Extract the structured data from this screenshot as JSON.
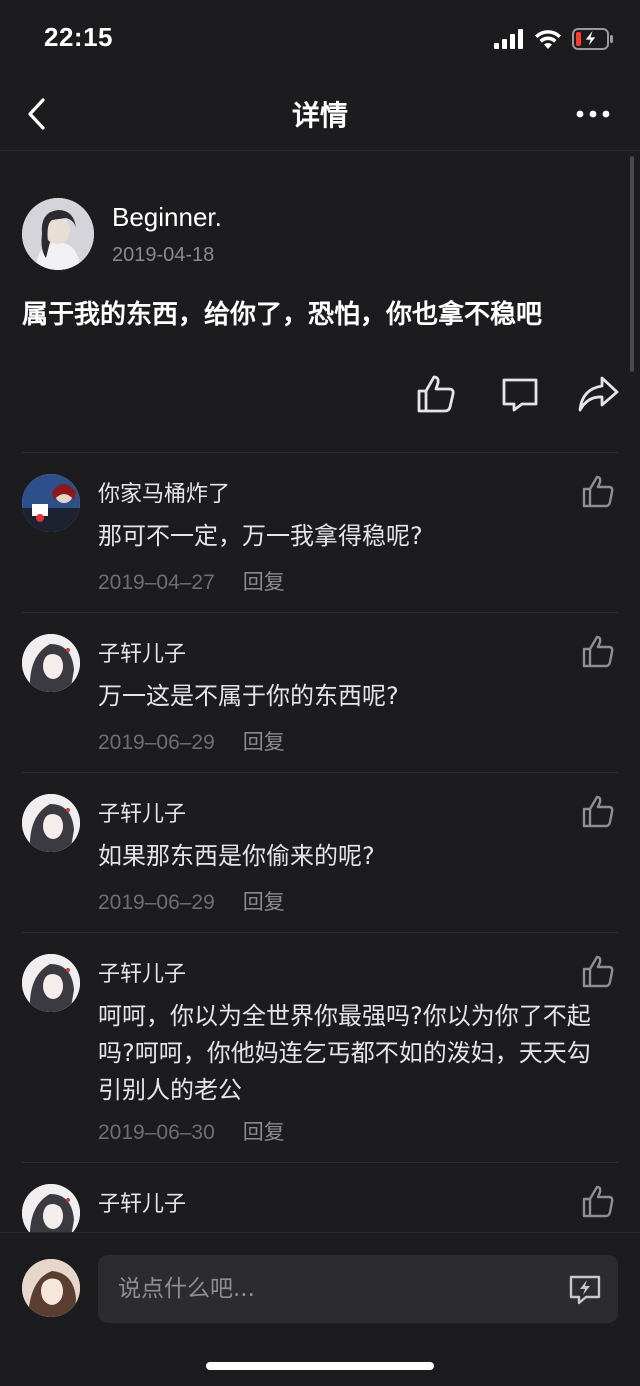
{
  "status_bar": {
    "time": "22:15",
    "battery_color": "#ff3b30"
  },
  "nav": {
    "title": "详情",
    "back_icon": "chevron-left-icon",
    "more_icon": "more-dots-icon"
  },
  "post": {
    "author": "Beginner.",
    "date": "2019-04-18",
    "content": "属于我的东西，给你了，恐怕，你也拿不稳吧",
    "actions": [
      "thumbs-up-icon",
      "comment-icon",
      "share-icon"
    ]
  },
  "comments": [
    {
      "name": "你家马桶炸了",
      "text": "那可不一定，万一我拿得稳呢?",
      "date": "2019–04–27",
      "reply": "回复"
    },
    {
      "name": "子轩儿子",
      "text": "万一这是不属于你的东西呢?",
      "date": "2019–06–29",
      "reply": "回复"
    },
    {
      "name": "子轩儿子",
      "text": "如果那东西是你偷来的呢?",
      "date": "2019–06–29",
      "reply": "回复"
    },
    {
      "name": "子轩儿子",
      "text": "呵呵，你以为全世界你最强吗?你以为你了不起吗?呵呵，你他妈连乞丐都不如的泼妇，天天勾引别人的老公",
      "date": "2019–06–30",
      "reply": "回复"
    },
    {
      "name": "子轩儿子",
      "text": "",
      "date": "",
      "reply": ""
    }
  ],
  "input": {
    "placeholder": "说点什么吧..."
  }
}
